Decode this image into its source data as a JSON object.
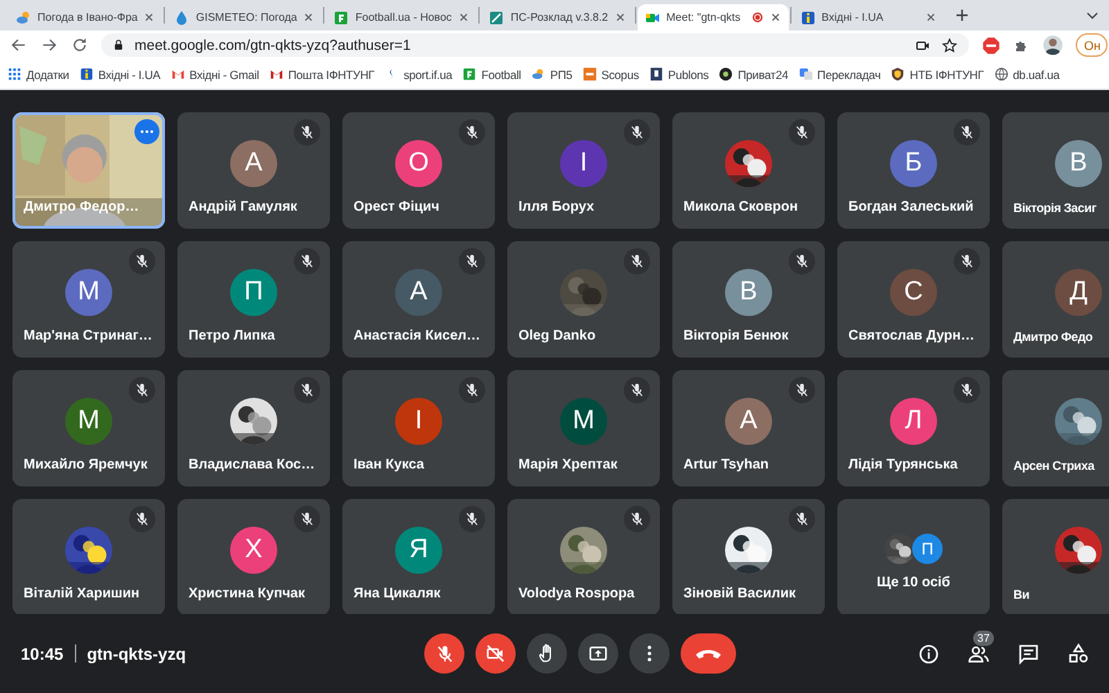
{
  "browser": {
    "tabs": [
      {
        "title": "Погода в Івано-Фра",
        "selected": false,
        "recording": false
      },
      {
        "title": "GISMETEO: Погода",
        "selected": false,
        "recording": false
      },
      {
        "title": "Football.ua - Новос",
        "selected": false,
        "recording": false
      },
      {
        "title": "ПС-Розклад v.3.8.2",
        "selected": false,
        "recording": false
      },
      {
        "title": "Meet: \"gtn-qkts",
        "selected": true,
        "recording": true
      },
      {
        "title": "Вхідні - I.UA",
        "selected": false,
        "recording": false
      }
    ],
    "url": "meet.google.com/gtn-qkts-yzq?authuser=1",
    "profile_button": "Он",
    "bookmarks": [
      "Додатки",
      "Вхідні - I.UA",
      "Вхідні - Gmail",
      "Пошта ІФНТУНГ",
      "sport.if.ua",
      "Football",
      "РП5",
      "Scopus",
      "Publons",
      "Приват24",
      "Перекладач",
      "НТБ ІФНТУНГ",
      "db.uaf.ua"
    ]
  },
  "meeting": {
    "tiles": [
      {
        "kind": "self",
        "name": "Дмитро Федор…",
        "muted": false
      },
      {
        "kind": "initial",
        "initial": "А",
        "color": "#8d6e63",
        "name": "Андрій Гамуляк",
        "muted": true
      },
      {
        "kind": "initial",
        "initial": "О",
        "color": "#ec407a",
        "name": "Орест Фіцич",
        "muted": true
      },
      {
        "kind": "initial",
        "initial": "І",
        "color": "#5e35b1",
        "name": "Ілля Борух",
        "muted": true
      },
      {
        "name": "Микола Сковрон",
        "muted": true
      },
      {
        "kind": "initial",
        "initial": "Б",
        "color": "#5c6bc0",
        "name": "Богдан Залеський",
        "muted": true
      },
      {
        "kind": "initial",
        "initial": "В",
        "color": "#78909c",
        "name": "Вікторія Засиг",
        "muted": false
      },
      {
        "kind": "initial",
        "initial": "М",
        "color": "#5c6bc0",
        "name": "Мар'яна Стринаг…",
        "muted": true
      },
      {
        "kind": "initial",
        "initial": "П",
        "color": "#00897b",
        "name": "Петро Липка",
        "muted": true
      },
      {
        "kind": "initial",
        "initial": "А",
        "color": "#455a64",
        "name": "Анастасія Кисел…",
        "muted": true
      },
      {
        "name": "Oleg Danko",
        "muted": true
      },
      {
        "kind": "initial",
        "initial": "В",
        "color": "#78909c",
        "name": "Вікторія Бенюк",
        "muted": true
      },
      {
        "kind": "initial",
        "initial": "С",
        "color": "#6d4c41",
        "name": "Святослав Дурн…",
        "muted": true
      },
      {
        "kind": "initial",
        "initial": "Д",
        "color": "#6d4c41",
        "name": "Дмитро Федо",
        "muted": false
      },
      {
        "kind": "initial",
        "initial": "М",
        "color": "#33691e",
        "name": "Михайло Яремчук",
        "muted": true
      },
      {
        "name": "Владислава Кос…",
        "muted": true
      },
      {
        "kind": "initial",
        "initial": "І",
        "color": "#bf360c",
        "name": "Іван Кукса",
        "muted": true
      },
      {
        "kind": "initial",
        "initial": "М",
        "color": "#004d40",
        "name": "Марія Хрептак",
        "muted": true
      },
      {
        "kind": "initial",
        "initial": "А",
        "color": "#8d6e63",
        "name": "Artur Tsyhan",
        "muted": true
      },
      {
        "kind": "initial",
        "initial": "Л",
        "color": "#ec407a",
        "name": "Лідія Турянська",
        "muted": true
      },
      {
        "name": "Арсен Стриха",
        "muted": false
      },
      {
        "name": "Віталій Харишин",
        "muted": true
      },
      {
        "kind": "initial",
        "initial": "Х",
        "color": "#ec407a",
        "name": "Христина Купчак",
        "muted": true
      },
      {
        "kind": "initial",
        "initial": "Я",
        "color": "#00897b",
        "name": "Яна Цикаляк",
        "muted": true
      },
      {
        "name": "Volodya Rospopa",
        "muted": true
      },
      {
        "name": "Зіновій Василик",
        "muted": true
      },
      {
        "kind": "more",
        "initial": "П",
        "color": "#1e88e5",
        "name": "Ще 10 осіб",
        "muted": false
      },
      {
        "name": "Ви",
        "muted": false
      }
    ],
    "time": "10:45",
    "code": "gtn-qkts-yzq",
    "controls": [
      {
        "kind": "mic",
        "on": false
      },
      {
        "kind": "camera",
        "on": false
      },
      {
        "kind": "hand"
      },
      {
        "kind": "present"
      },
      {
        "kind": "more"
      },
      {
        "kind": "end"
      }
    ],
    "participant_count": "37"
  }
}
